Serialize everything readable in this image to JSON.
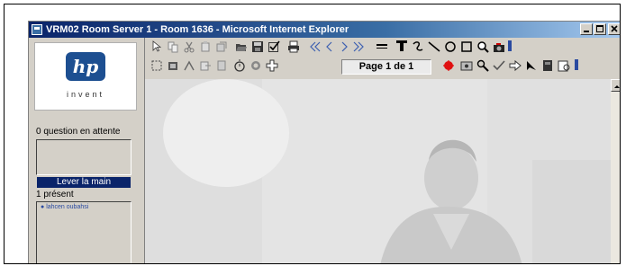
{
  "window": {
    "title": "VRM02 Room Server 1 - Room 1636 - Microsoft Internet Explorer",
    "buttons": [
      "minimize-icon",
      "maximize-icon",
      "close-icon"
    ]
  },
  "sidebar": {
    "logo_text": "hp",
    "tagline": "invent",
    "queue_label": "0 question en attente",
    "raise_hand_label": "Lever la main",
    "present_label": "1 présent",
    "participants": [
      "lahcen oubahsi"
    ]
  },
  "toolbar": {
    "page_indicator": "Page 1 de 1",
    "row1_icons": [
      "pointer-icon",
      "copy-icon",
      "cut-icon",
      "paste-icon",
      "duplicate-icon",
      "open-folder-icon",
      "save-icon",
      "checklist-icon",
      "print-icon",
      "first-page-icon",
      "previous-page-icon",
      "next-page-icon",
      "last-page-icon",
      "line-width-icon",
      "text-icon",
      "freehand-icon",
      "line-icon",
      "ellipse-icon",
      "rectangle-icon",
      "zoom-icon",
      "camera-icon"
    ],
    "row2_icons": [
      "select-area-icon",
      "stamp-icon",
      "crop-icon",
      "export-icon",
      "import-icon",
      "timer-icon",
      "settings-icon",
      "add-icon",
      "highlight-red-icon",
      "screenshot-icon",
      "magnify-icon",
      "check-mark-icon",
      "arrow-icon",
      "pointer-arrow-icon",
      "book-icon",
      "preview-icon"
    ]
  },
  "colors": {
    "titlebar": "#0a246a",
    "raise_hand_bg": "#0a246a",
    "hp_blue": "#1d4f91",
    "chrome": "#d4d0c8"
  }
}
